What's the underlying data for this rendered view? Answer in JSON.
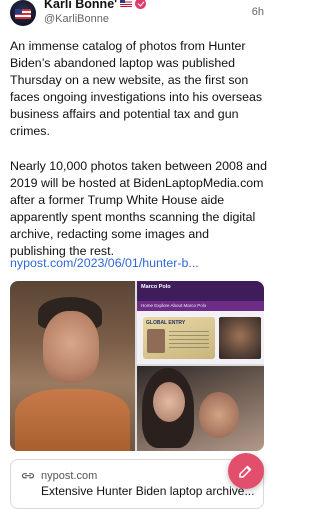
{
  "post": {
    "author_name": "Karli Bonne'",
    "handle": "@KarliBonne",
    "time": "6h",
    "paragraphs": [
      "An immense catalog of photos from Hunter Biden’s abandoned laptop was published Thursday on a new website, as the first son faces ongoing investigations into his overseas business affairs and potential tax and gun crimes.",
      "Nearly 10,000 photos taken between 2008 and 2019 will be hosted at BidenLaptopMedia.com after a former Trump White House aide apparently spent months scanning the digital archive, redacting some images and publishing the rest."
    ],
    "link_text": "nypost.com/2023/06/01/hunter-b..."
  },
  "media": {
    "site_logo": "Marco Polo",
    "site_nav": "Home  Explore  About  Marco Polo",
    "passport_title": "GLOBAL ENTRY"
  },
  "link_card": {
    "domain": "nypost.com",
    "title": "Extensive Hunter Biden laptop archive..."
  },
  "icons": {
    "verified": "verified-badge-icon",
    "link": "link-icon",
    "compose": "compose-icon"
  },
  "colors": {
    "link": "#2f68d8",
    "fab": "#e24f6d",
    "verified": "#e03a6a"
  }
}
